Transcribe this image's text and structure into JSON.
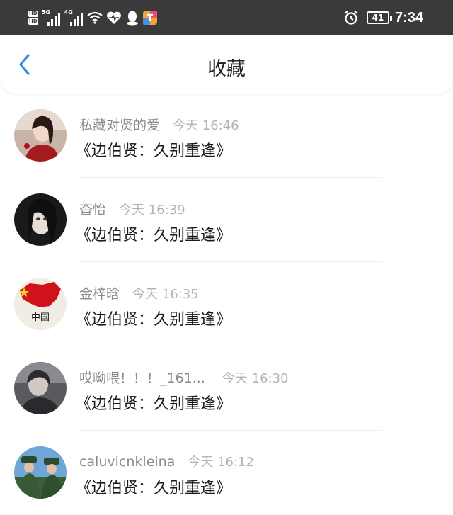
{
  "status_bar": {
    "hd_badge": "HD",
    "net1_label": "5G",
    "net2_label": "4G",
    "battery": "41",
    "time": "7:34",
    "icons": [
      "wifi-icon",
      "heartbeat-icon",
      "qq-icon",
      "app-icon",
      "alarm-icon"
    ]
  },
  "header": {
    "title": "收藏",
    "back_icon": "chevron-left-icon",
    "accent_color": "#2f8be6"
  },
  "favorites": [
    {
      "user": "私藏对贤的爱",
      "time": "今天 16:46",
      "title": "《边伯贤：久别重逢》",
      "avatar": "avatar-1"
    },
    {
      "user": "杳怡",
      "time": "今天 16:39",
      "title": "《边伯贤：久别重逢》",
      "avatar": "avatar-2"
    },
    {
      "user": "金梓晗",
      "time": "今天 16:35",
      "title": "《边伯贤：久别重逢》",
      "avatar": "avatar-3",
      "avatar_text": "中国"
    },
    {
      "user": "哎呦喂！！！_161...",
      "time": "今天 16:30",
      "title": "《边伯贤：久别重逢》",
      "avatar": "avatar-4"
    },
    {
      "user": "caluvicnkleina",
      "time": "今天 16:12",
      "title": "《边伯贤：久别重逢》",
      "avatar": "avatar-5"
    }
  ]
}
